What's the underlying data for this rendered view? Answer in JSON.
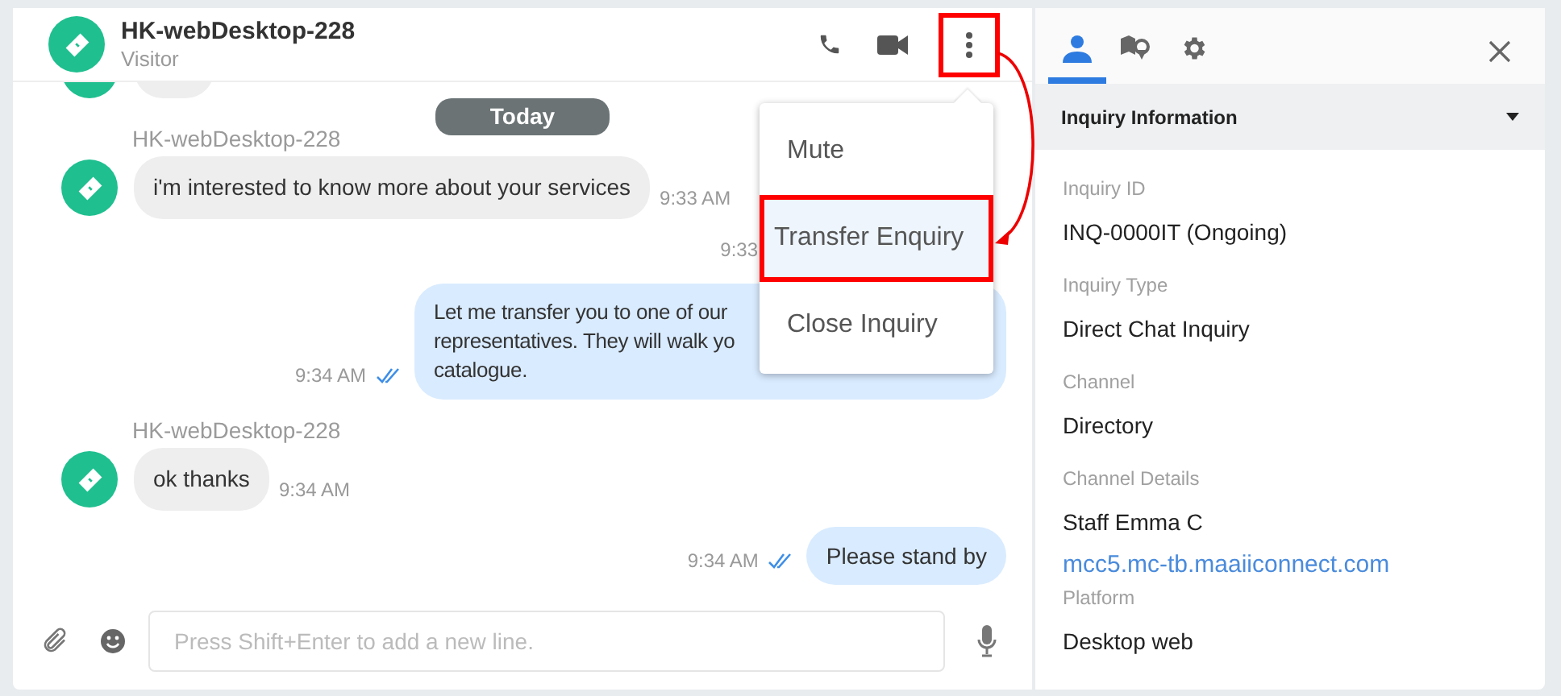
{
  "header": {
    "name": "HK-webDesktop-228",
    "subtitle": "Visitor",
    "more_highlighted": true
  },
  "date_divider": "Today",
  "messages": [
    {
      "kind": "incoming",
      "sender": "HK-webDesktop-228",
      "lines": [
        "i'm interested to know more about your services"
      ],
      "time": "9:33 AM"
    },
    {
      "kind": "hidden",
      "time": "9:33"
    },
    {
      "kind": "outgoing",
      "lines": [
        "Let me transfer you to one of our",
        "representatives. They will walk yo",
        "catalogue."
      ],
      "time": "9:34 AM",
      "read": true
    },
    {
      "kind": "incoming",
      "sender": "HK-webDesktop-228",
      "lines": [
        "ok thanks"
      ],
      "time": "9:34 AM"
    },
    {
      "kind": "outgoing",
      "lines": [
        "Please stand by"
      ],
      "time": "9:34 AM",
      "read": true
    }
  ],
  "menu": {
    "items": [
      {
        "label": "Mute",
        "selected": false
      },
      {
        "label": "Transfer Enquiry",
        "selected": true
      },
      {
        "label": "Close Inquiry",
        "selected": false
      }
    ]
  },
  "composer": {
    "placeholder": "Press Shift+Enter to add a new line."
  },
  "panel": {
    "tabs": [
      {
        "kind": "person",
        "selected": true
      },
      {
        "kind": "map",
        "selected": false
      },
      {
        "kind": "settings",
        "selected": false
      }
    ],
    "section": {
      "title": "Inquiry Information",
      "expanded": true
    },
    "items": [
      {
        "kind": "label",
        "text": "Inquiry ID"
      },
      {
        "kind": "value",
        "text": "INQ-0000IT (Ongoing)"
      },
      {
        "kind": "label",
        "text": "Inquiry Type"
      },
      {
        "kind": "value",
        "text": "Direct Chat Inquiry"
      },
      {
        "kind": "label",
        "text": "Channel"
      },
      {
        "kind": "value",
        "text": "Directory"
      },
      {
        "kind": "label",
        "text": "Channel Details"
      },
      {
        "kind": "value",
        "text": "Staff Emma C"
      },
      {
        "kind": "link",
        "text": "mcc5.mc-tb.maaiiconnect.com"
      },
      {
        "kind": "label",
        "text": "Platform"
      },
      {
        "kind": "value",
        "text": "Desktop web"
      }
    ]
  }
}
